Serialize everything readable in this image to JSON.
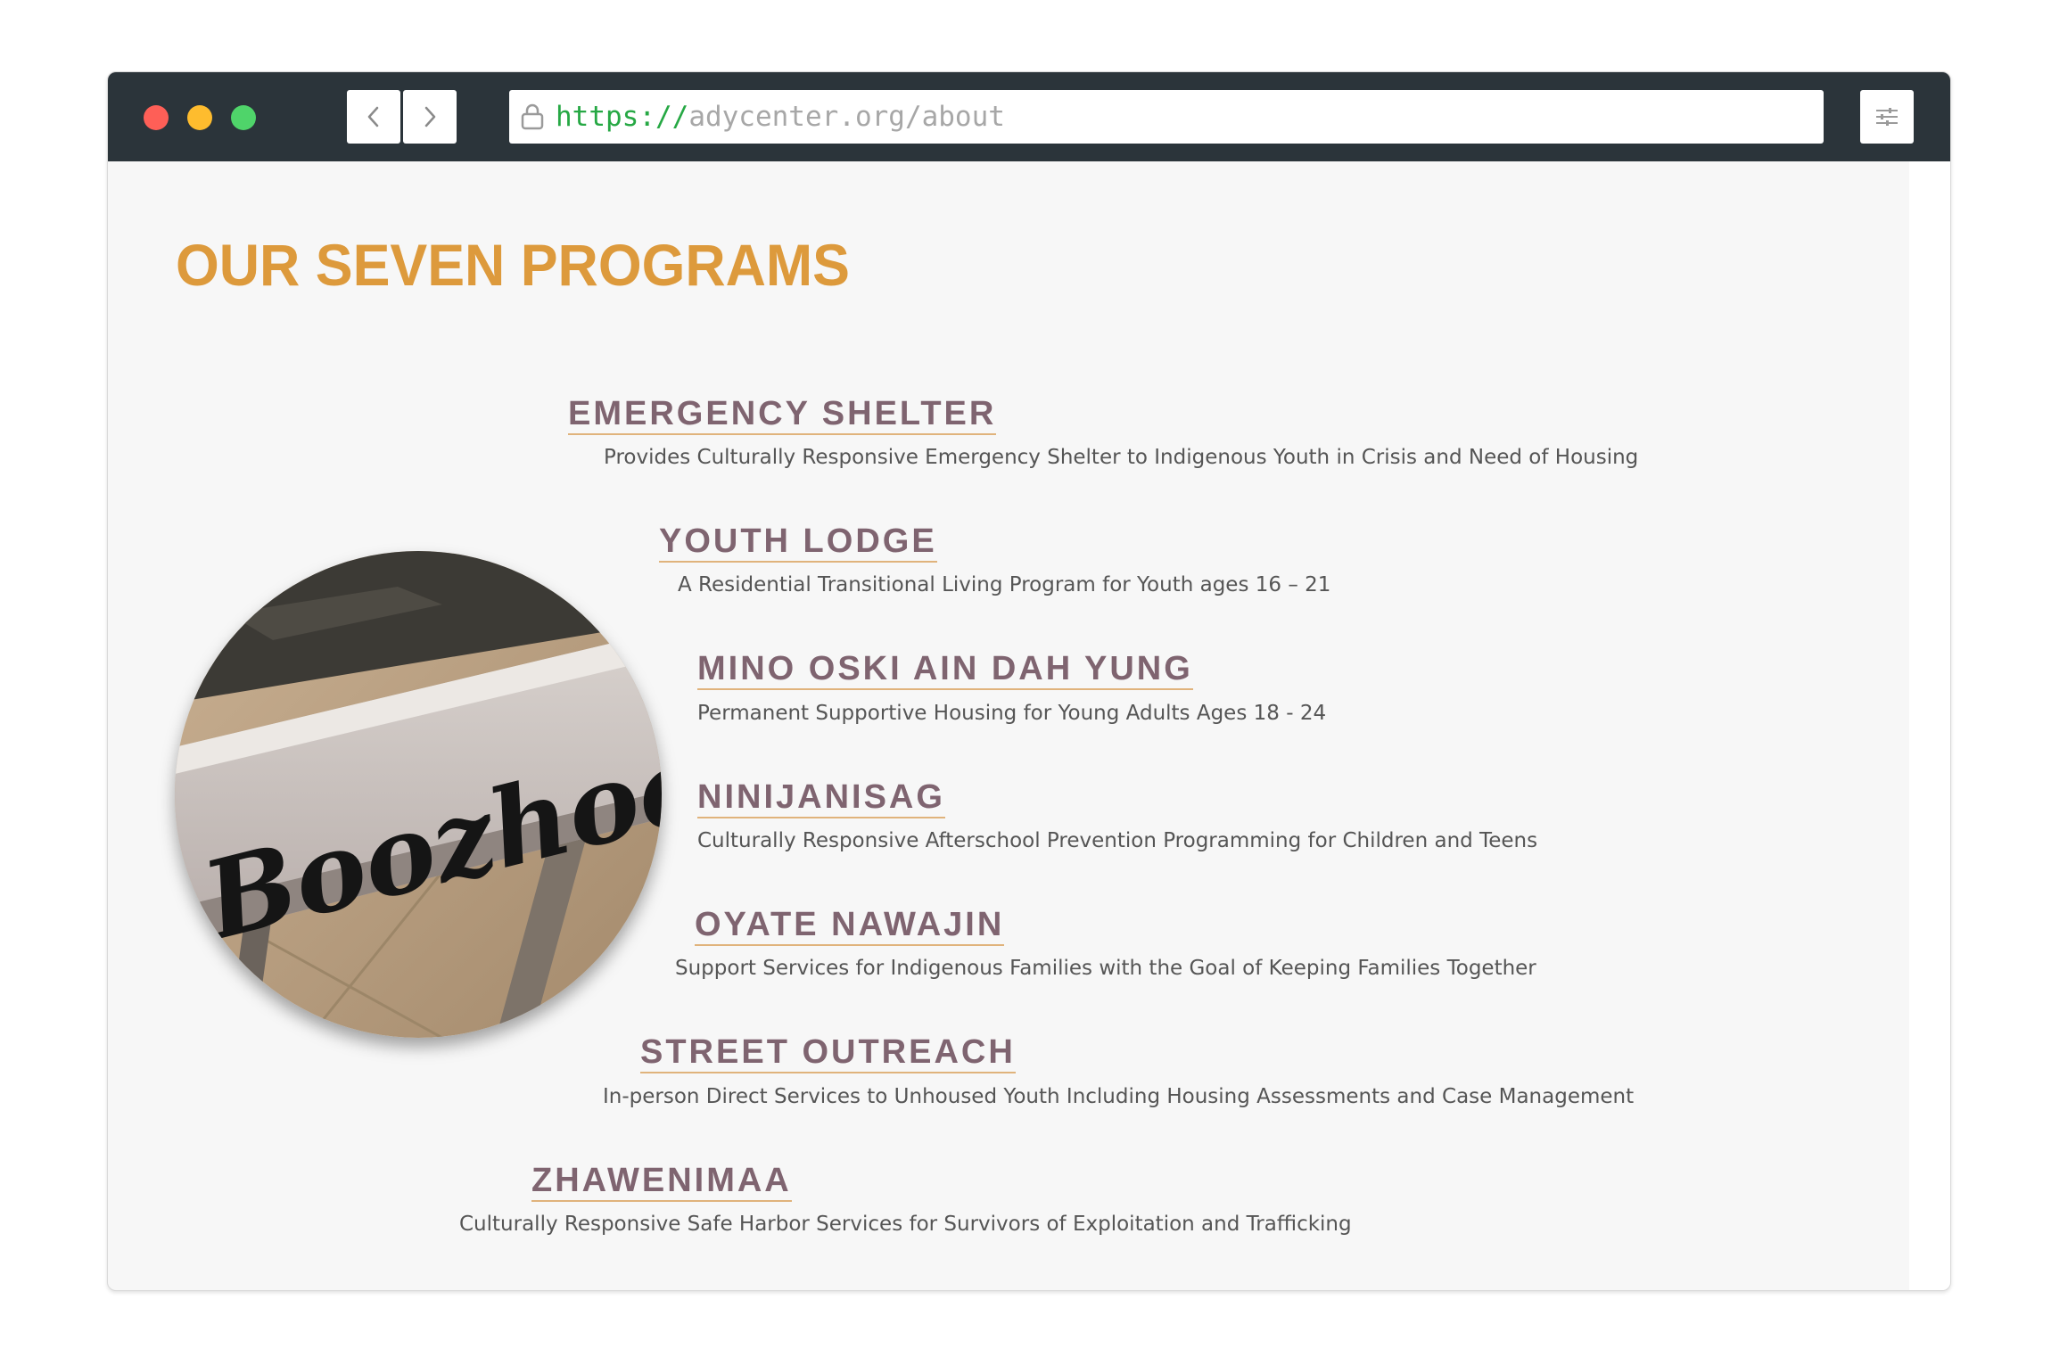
{
  "browser": {
    "url_scheme": "https://",
    "url_rest": "adycenter.org/about"
  },
  "page": {
    "title": "OUR SEVEN PROGRAMS",
    "image_text": "Boozhoo"
  },
  "programs": [
    {
      "title": "EMERGENCY SHELTER",
      "desc": "Provides Culturally Responsive Emergency Shelter to Indigenous Youth in Crisis and Need of Housing"
    },
    {
      "title": "YOUTH LODGE",
      "desc": "A Residential Transitional Living Program for Youth ages 16 – 21"
    },
    {
      "title": "MINO OSKI AIN DAH YUNG",
      "desc": "Permanent Supportive Housing for Young Adults Ages 18 - 24"
    },
    {
      "title": "NINIJANISAG",
      "desc": "Culturally Responsive Afterschool Prevention Programming for Children and Teens"
    },
    {
      "title": "OYATE NAWAJIN",
      "desc": "Support Services for Indigenous Families with the Goal of Keeping Families Together"
    },
    {
      "title": "STREET OUTREACH",
      "desc": "In-person Direct Services to Unhoused Youth Including Housing Assessments and Case Management"
    },
    {
      "title": "ZHAWENIMAA",
      "desc": "Culturally Responsive Safe Harbor Services for Survivors of Exploitation and Trafficking"
    }
  ]
}
